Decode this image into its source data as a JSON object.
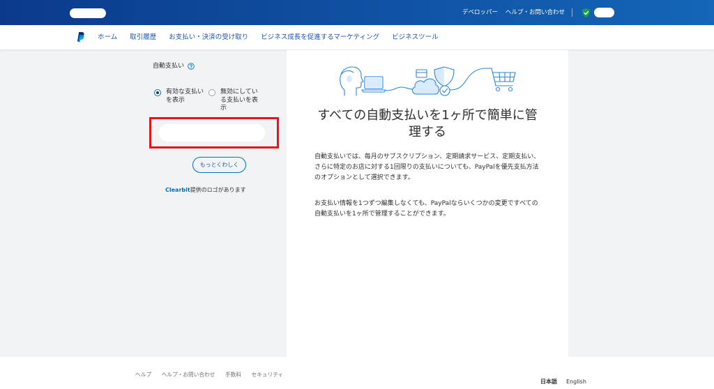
{
  "colors": {
    "header_dark": "#0b3a8b",
    "header_light": "#1466b8",
    "brand_blue": "#0070ba",
    "nav_text": "#1f55a5",
    "text_dark": "#2c2e2f",
    "highlight_red": "#e5151d",
    "status_green": "#1f9d4b",
    "page_bg": "#f2f3f5",
    "illustration_blue": "#2a86dc",
    "illustration_fill": "#d9ebfb",
    "muted_text": "#6c7378"
  },
  "header": {
    "developer_label": "デベロッパー",
    "help_label": "ヘルプ・お問い合わせ",
    "security_icon": "shield-check-icon"
  },
  "nav": {
    "logo_icon": "paypal-logo-icon",
    "items": [
      {
        "label": "ホーム"
      },
      {
        "label": "取引履歴"
      },
      {
        "label": "お支払い・決済の受け取り"
      },
      {
        "label": "ビジネス成長を促進するマーケティング"
      },
      {
        "label": "ビジネスツール"
      }
    ]
  },
  "sidebar": {
    "title": "自動支払い",
    "help_icon": "question-circle-icon",
    "filters": [
      {
        "label": "有効な支払いを表示",
        "selected": true
      },
      {
        "label": "無効にしている支払いを表示",
        "selected": false
      }
    ],
    "learn_more_label": "もっとくわしく",
    "clearbit_brand": "Clearbit",
    "clearbit_note": "提供のロゴがあります"
  },
  "main": {
    "illustration_icons": [
      "person-icon",
      "laptop-icon",
      "cloud-icon",
      "card-icon",
      "shield-icon",
      "check-circle-icon",
      "shopping-cart-icon"
    ],
    "heading": "すべての自動支払いを1ヶ所で簡単に管理する",
    "paragraphs": [
      "自動支払いでは、毎月のサブスクリプション、定期請求サービス、定期支払い、さらに特定のお店に対する1回限りの支払いについても、PayPalを優先支払方法のオプションとして選択できます。",
      "お支払い情報を1つずつ編集しなくても、PayPalならいくつかの変更ですべての自動支払いを1ヶ所で管理することができます。"
    ]
  },
  "footer": {
    "links": [
      {
        "label": "ヘルプ"
      },
      {
        "label": "ヘルプ・お問い合わせ"
      },
      {
        "label": "手数料"
      },
      {
        "label": "セキュリティ"
      }
    ],
    "languages": [
      {
        "label": "日本語",
        "active": true
      },
      {
        "label": "English",
        "active": false
      }
    ]
  }
}
